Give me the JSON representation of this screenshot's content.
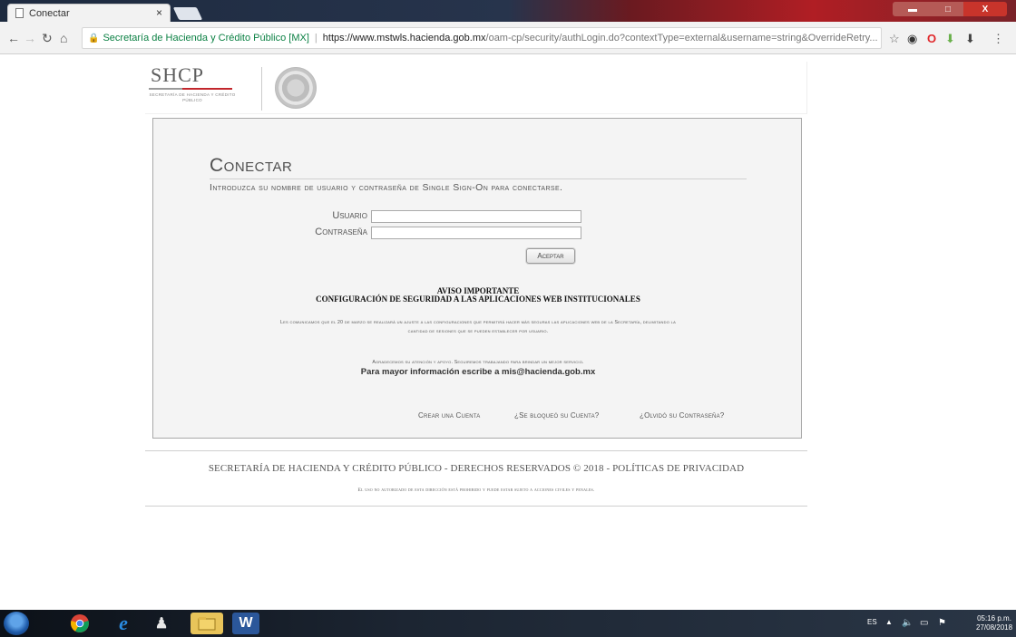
{
  "browser": {
    "tab_title": "Conectar",
    "tab_close": "×",
    "site_name": "Secretaría de Hacienda y Crédito Público [MX]",
    "url_host": "https://www.mstwls.hacienda.gob.mx",
    "url_path": "/oam-cp/security/authLogin.do?contextType=external&username=string&OverrideRetry...",
    "window_controls": {
      "minimize": "▬",
      "maximize": "□",
      "close": "X"
    }
  },
  "header": {
    "logo_text": "SHCP",
    "logo_sub": "SECRETARÍA DE HACIENDA Y CRÉDITO PÚBLICO"
  },
  "login": {
    "title": "Conectar",
    "subtitle": "Introduzca su nombre de usuario y contraseña de Single Sign-On para conectarse.",
    "username_label": "Usuario",
    "password_label": "Contraseña",
    "submit_label": "Aceptar"
  },
  "notice": {
    "heading": "AVISO IMPORTANTE",
    "subheading": "CONFIGURACIÓN DE SEGURIDAD A LAS APLICACIONES WEB INSTITUCIONALES",
    "body": "Les comunicamos que el 20 de marzo se realizará un ajuste a las configuraciones que permitirá hacer más seguras las aplicaciones web de la Secretaría, delimitando la cantidad de sesiones que se pueden establecer por usuario.",
    "thanks": "Agradecemos su atención y apoyo. Seguiremos trabajando para brindar un mejor servicio.",
    "contact": "Para mayor información escribe a mis@hacienda.gob.mx"
  },
  "links": {
    "create_account": "Crear una Cuenta",
    "locked_account": "¿Se bloqueó su Cuenta?",
    "forgot_password": "¿Olvidó su Contraseña?"
  },
  "footer": {
    "main": "SECRETARÍA DE HACIENDA Y CRÉDITO PÚBLICO - DERECHOS RESERVADOS © 2018 - POLÍTICAS DE PRIVACIDAD",
    "legal": "El uso no autorizado de esta dirección está prohibido y puede estar sujeto a acciones civiles y penales."
  },
  "taskbar": {
    "word_label": "W",
    "language": "ES",
    "time": "05:16 p.m.",
    "date": "27/08/2018"
  },
  "colors": {
    "panel_bg": "#f4f4f4",
    "panel_border": "#a8a8a8",
    "brand_red": "#c2272d",
    "secure_green": "#0b8043"
  }
}
